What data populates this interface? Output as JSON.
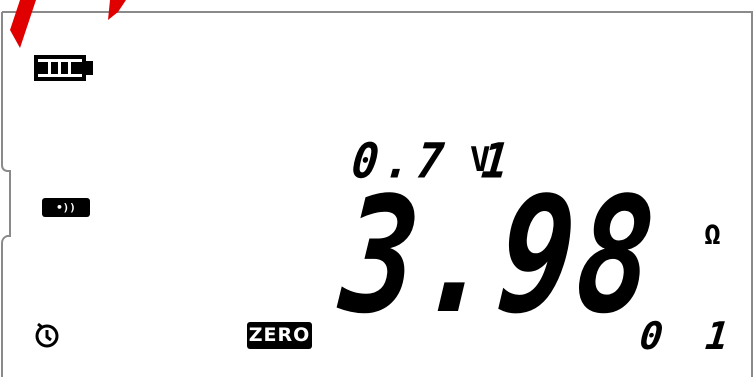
{
  "display": {
    "battery_icon": "battery-full-icon",
    "sound_icon": "sound-beep-icon",
    "timer_icon": "timer-icon",
    "sound_symbol": "•))",
    "secondary_reading": "0.7 1",
    "secondary_unit": "V",
    "main_reading": "3.98",
    "main_unit": "Ω",
    "zero_label": "ZERO",
    "range_code": "0 1",
    "battery_level": 1.0
  },
  "colors": {
    "segment": "#000000",
    "background": "#ffffff",
    "watermark": "#e00000",
    "frame": "#8a8a8a"
  }
}
